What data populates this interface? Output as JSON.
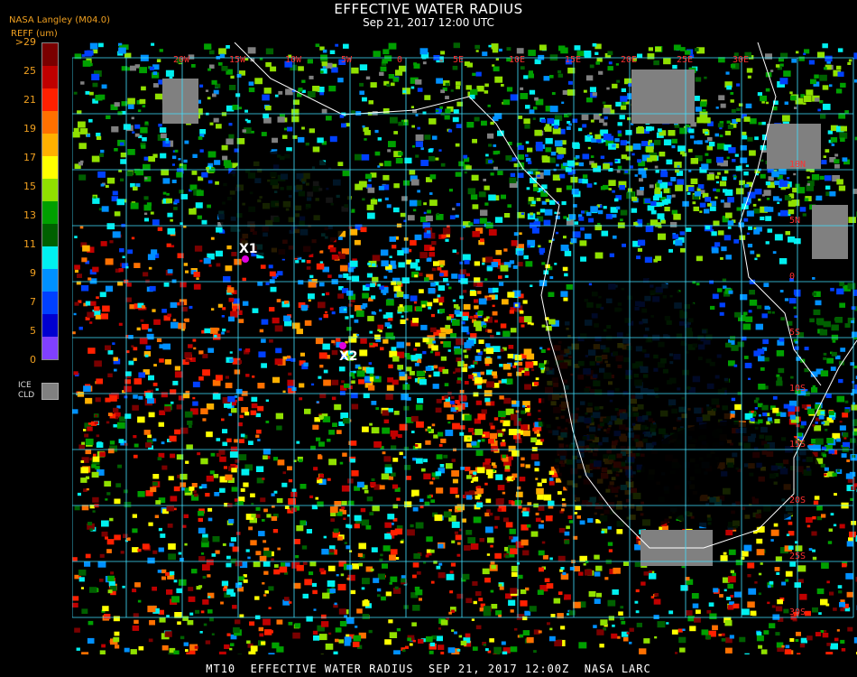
{
  "header": {
    "title": "EFFECTIVE WATER RADIUS",
    "subtitle": "Sep 21, 2017 12:00 UTC",
    "source": "NASA Langley (M04.0)",
    "units": "REFF (um)"
  },
  "legend": {
    "ticks": [
      ">29",
      "25",
      "21",
      "19",
      "17",
      "15",
      "13",
      "11",
      "9",
      "7",
      "5",
      "0"
    ],
    "colors": [
      "#7a0000",
      "#c00000",
      "#ff2000",
      "#ff7000",
      "#ffb000",
      "#ffff00",
      "#90e000",
      "#00a000",
      "#006000",
      "#00f0f0",
      "#0090ff",
      "#0040ff",
      "#0000d0",
      "#8040ff"
    ],
    "ice_label_1": "ICE",
    "ice_label_2": "CLD",
    "ice_color": "#808080"
  },
  "map": {
    "lon_labels": [
      "20W",
      "15W",
      "10W",
      "5W",
      "0",
      "5E",
      "10E",
      "15E",
      "20E",
      "25E",
      "30E"
    ],
    "lat_labels": [
      "10N",
      "5N",
      "0",
      "5S",
      "10S",
      "15S",
      "20S",
      "25S",
      "30S"
    ],
    "grid_color": "#40e0ff",
    "coast_color": "#ffffff",
    "markers": [
      {
        "label": "X1",
        "color": "#e000e0"
      },
      {
        "label": "X2",
        "color": "#e000e0"
      }
    ]
  },
  "footer": "MT10  EFFECTIVE WATER RADIUS  SEP 21, 2017 12:00Z  NASA LARC"
}
